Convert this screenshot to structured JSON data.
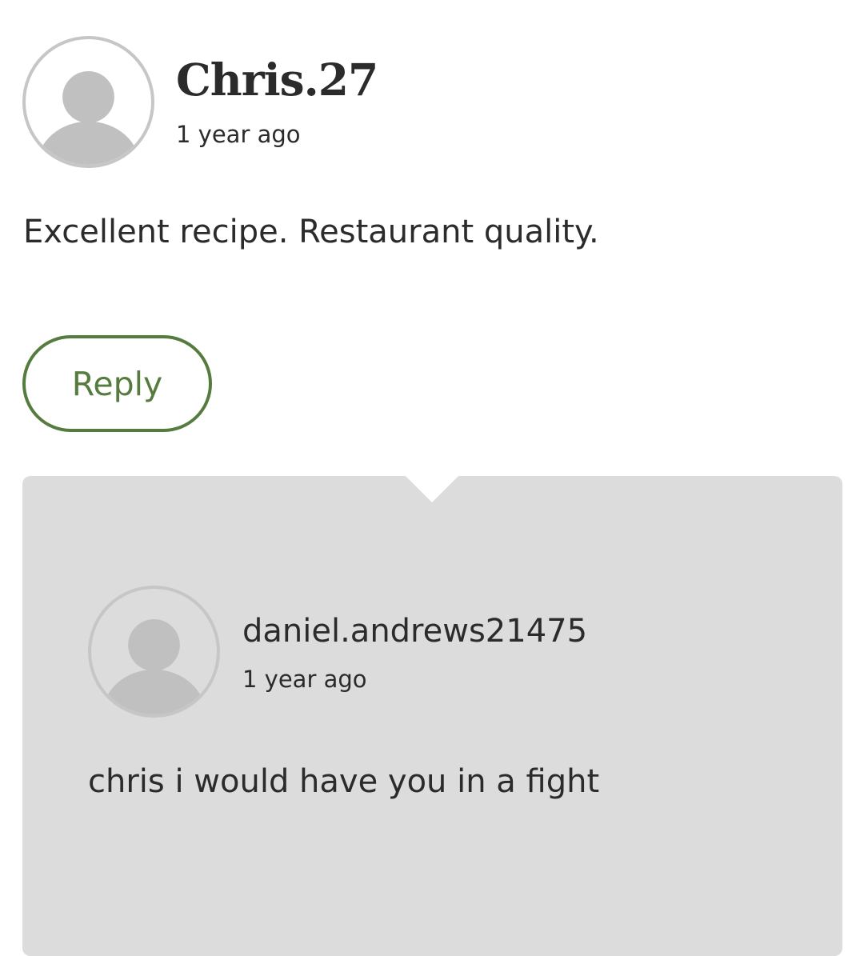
{
  "comment": {
    "username": "Chris.27",
    "timestamp": "1 year ago",
    "text": "Excellent recipe. Restaurant quality.",
    "avatar_icon": "default-user-avatar-icon"
  },
  "actions": {
    "reply_label": "Reply"
  },
  "reply": {
    "username": "daniel.andrews21475",
    "timestamp": "1 year ago",
    "text": "chris i would have you in a fight",
    "avatar_icon": "default-user-avatar-icon"
  },
  "colors": {
    "accent": "#557c3e",
    "reply_background": "#dcdcdc",
    "avatar_gray": "#c0c0c0",
    "text": "#2b2b2b"
  }
}
